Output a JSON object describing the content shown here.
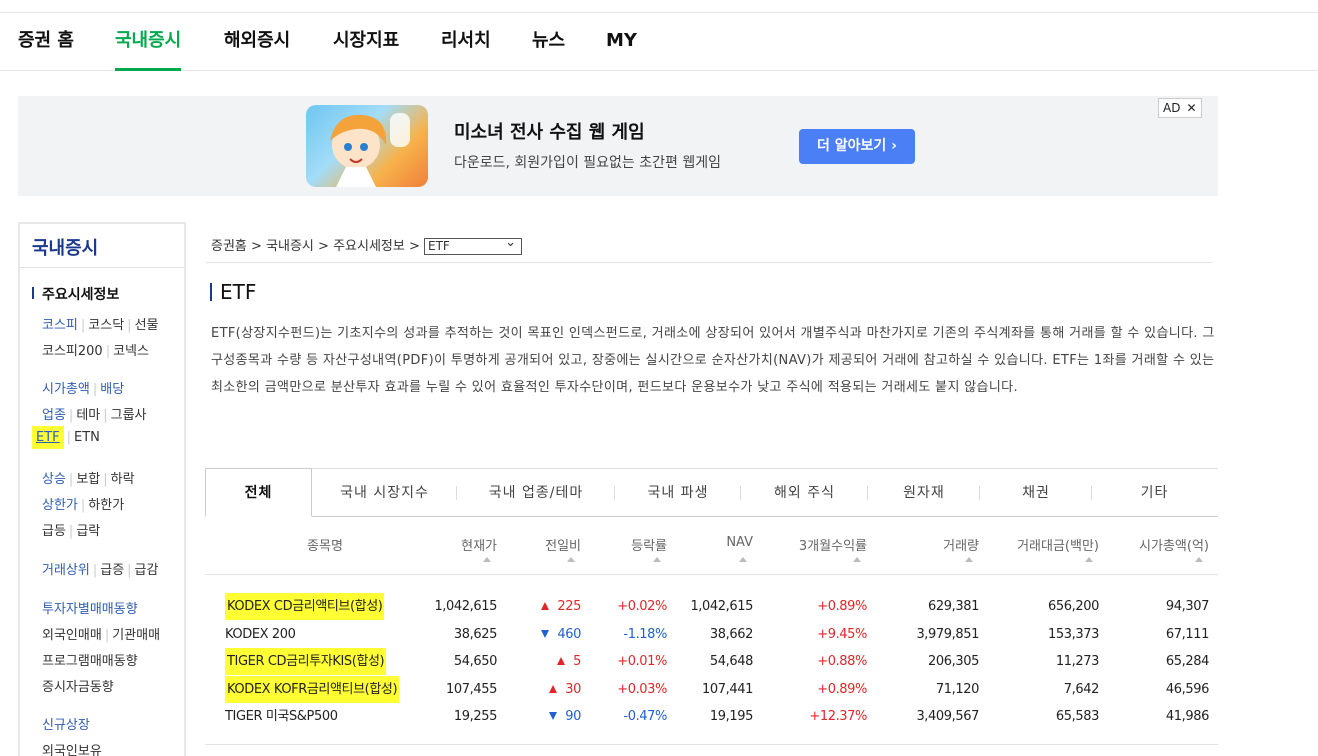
{
  "topnav": {
    "items": [
      "증권 홈",
      "국내증시",
      "해외증시",
      "시장지표",
      "리서치",
      "뉴스",
      "MY"
    ],
    "active_index": 1,
    "accent_color": "#03a94d"
  },
  "ad": {
    "title": "미소녀 전사 수집 웹 게임",
    "subtitle": "다운로드, 회원가입이 필요없는 초간편 웹게임",
    "cta": "더 알아보기 ›",
    "badge": "AD",
    "close": "✕"
  },
  "sidebar": {
    "header": "국내증시",
    "section": "주요시세정보",
    "links": {
      "kospi": "코스피",
      "kosdaq": "코스닥",
      "futures": "선물",
      "kospi200": "코스피200",
      "konex": "코넥스",
      "market_cap": "시가총액",
      "dividend": "배당",
      "sector": "업종",
      "theme": "테마",
      "group": "그룹사",
      "etf": "ETF",
      "etn": "ETN",
      "rise": "상승",
      "flat": "보합",
      "fall": "하락",
      "upper_limit": "상한가",
      "lower_limit": "하한가",
      "surge": "급등",
      "plunge": "급락",
      "top_volume": "거래상위",
      "vol_increase": "급증",
      "vol_decrease": "급감",
      "investor_trading": "투자자별매매동향",
      "foreign_inst": "외국인매매",
      "institution": "기관매매",
      "program_trading": "프로그램매매동향",
      "deposit": "증시자금동향",
      "new_listing": "신규상장",
      "foreign_holding": "외국인보유"
    }
  },
  "breadcrumb": {
    "home": "증권홈 >",
    "domestic": "국내증시 >",
    "major": "주요시세정보 >",
    "select_value": "ETF"
  },
  "page": {
    "title": "ETF",
    "description": "ETF(상장지수펀드)는 기초지수의 성과를 추적하는 것이 목표인 인덱스펀드로, 거래소에 상장되어 있어서 개별주식과 마찬가지로 기존의 주식계좌를 통해 거래를 할 수 있습니다. 그 구성종목과 수량 등 자산구성내역(PDF)이 투명하게 공개되어 있고, 장중에는 실시간으로 순자산가치(NAV)가 제공되어 거래에 참고하실 수 있습니다. ETF는 1좌를 거래할 수 있는 최소한의 금액만으로 분산투자 효과를 누릴 수 있어 효율적인 투자수단이며, 펀드보다 운용보수가 낮고 주식에 적용되는 거래세도 붙지 않습니다."
  },
  "tabs": [
    "전체",
    "국내 시장지수",
    "국내 업종/테마",
    "국내 파생",
    "해외 주식",
    "원자재",
    "채권",
    "기타"
  ],
  "table": {
    "headers": [
      "종목명",
      "현재가",
      "전일비",
      "등락률",
      "NAV",
      "3개월수익률",
      "거래량",
      "거래대금(백만)",
      "시가총액(억)"
    ],
    "rows": [
      {
        "name": "KODEX CD금리액티브(합성)",
        "price": "1,042,615",
        "dir": "up",
        "change": "225",
        "rate": "+0.02%",
        "nav": "1,042,615",
        "ret3m": "+0.89%",
        "volume": "629,381",
        "amount": "656,200",
        "mcap": "94,307",
        "highlight": true
      },
      {
        "name": "KODEX 200",
        "price": "38,625",
        "dir": "down",
        "change": "460",
        "rate": "-1.18%",
        "nav": "38,662",
        "ret3m": "+9.45%",
        "volume": "3,979,851",
        "amount": "153,373",
        "mcap": "67,111",
        "highlight": false
      },
      {
        "name": "TIGER CD금리투자KIS(합성)",
        "price": "54,650",
        "dir": "up",
        "change": "5",
        "rate": "+0.01%",
        "nav": "54,648",
        "ret3m": "+0.88%",
        "volume": "206,305",
        "amount": "11,273",
        "mcap": "65,284",
        "highlight": true
      },
      {
        "name": "KODEX KOFR금리액티브(합성)",
        "price": "107,455",
        "dir": "up",
        "change": "30",
        "rate": "+0.03%",
        "nav": "107,441",
        "ret3m": "+0.89%",
        "volume": "71,120",
        "amount": "7,642",
        "mcap": "46,596",
        "highlight": true
      },
      {
        "name": "TIGER 미국S&P500",
        "price": "19,255",
        "dir": "down",
        "change": "90",
        "rate": "-0.47%",
        "nav": "19,195",
        "ret3m": "+12.37%",
        "volume": "3,409,567",
        "amount": "65,583",
        "mcap": "41,986",
        "highlight": false
      }
    ]
  }
}
